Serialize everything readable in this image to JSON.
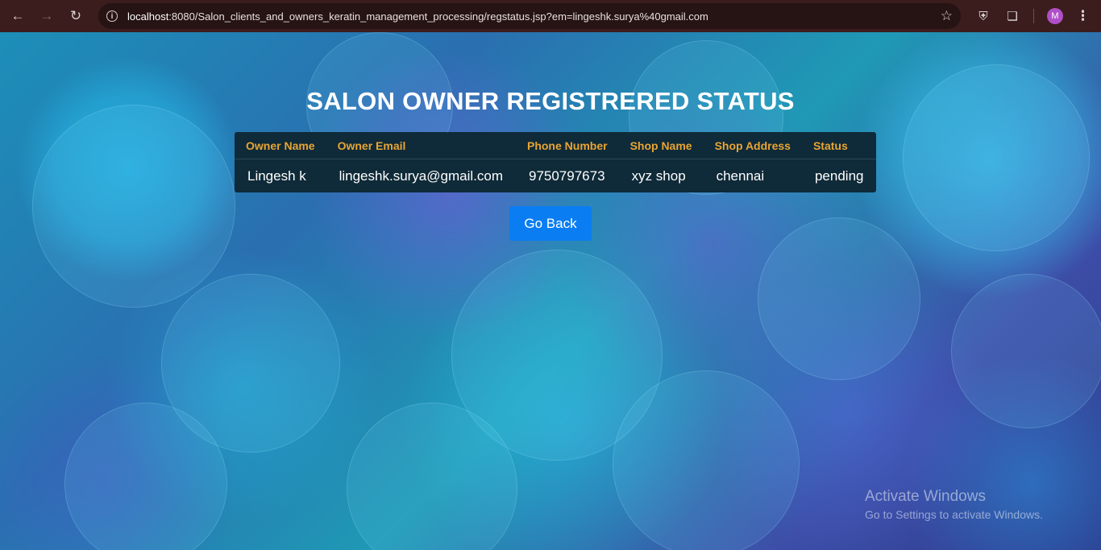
{
  "browser": {
    "url_host": "localhost",
    "url_rest": ":8080/Salon_clients_and_owners_keratin_management_processing/regstatus.jsp?em=lingeshk.surya%40gmail.com",
    "profile_initial": "M"
  },
  "page": {
    "title": "SALON OWNER REGISTRERED STATUS",
    "go_back_label": "Go Back"
  },
  "table": {
    "columns": [
      "Owner Name",
      "Owner Email",
      "Phone Number",
      "Shop Name",
      "Shop Address",
      "Status"
    ],
    "rows": [
      [
        "Lingesh k",
        "lingeshk.surya@gmail.com",
        "9750797673",
        "xyz shop",
        "chennai",
        "pending"
      ]
    ]
  },
  "watermark": {
    "title": "Activate Windows",
    "subtitle": "Go to Settings to activate Windows."
  },
  "colors": {
    "header_text": "#e8a534",
    "table_bg": "#0f2a38",
    "button_bg": "#0a7df2"
  },
  "icons": [
    "back-arrow-icon",
    "forward-arrow-icon",
    "reload-icon",
    "info-icon",
    "star-icon",
    "shield-icon",
    "extensions-icon",
    "menu-icon"
  ]
}
